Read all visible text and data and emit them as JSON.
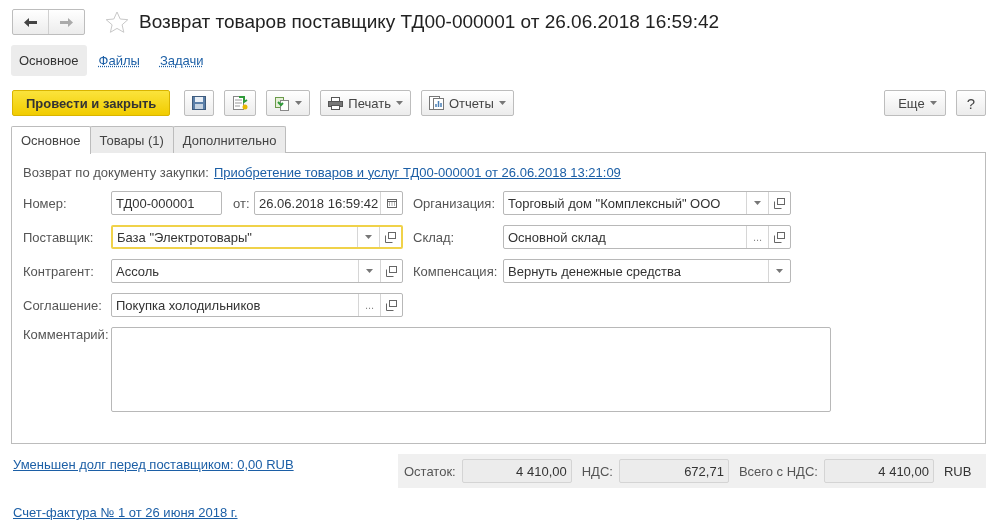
{
  "header": {
    "title": "Возврат товаров поставщику ТД00-000001 от 26.06.2018 16:59:42",
    "favorite": false
  },
  "sections": [
    {
      "label": "Основное",
      "selected": true
    },
    {
      "label": "Файлы",
      "selected": false
    },
    {
      "label": "Задачи",
      "selected": false
    }
  ],
  "toolbar": {
    "primary": "Провести и закрыть",
    "print": "Печать",
    "reports": "Отчеты",
    "more": "Еще",
    "help": "?"
  },
  "tabs": [
    {
      "label": "Основное",
      "selected": true
    },
    {
      "label": "Товары (1)",
      "selected": false
    },
    {
      "label": "Дополнительно",
      "selected": false
    }
  ],
  "basis": {
    "label": "Возврат по документу закупки:",
    "link": "Приобретение товаров и услуг ТД00-000001 от 26.06.2018 13:21:09"
  },
  "number": {
    "label": "Номер:",
    "value": "ТД00-000001",
    "date_label": "от:",
    "date": "26.06.2018 16:59:42"
  },
  "left_fields": [
    {
      "label": "Поставщик:",
      "value": "База \"Электротовары\"",
      "focused": true,
      "dropdown": true,
      "open": true
    },
    {
      "label": "Контрагент:",
      "value": "Ассоль",
      "focused": false,
      "dropdown": true,
      "open": true
    },
    {
      "label": "Соглашение:",
      "value": "Покупка холодильников",
      "focused": false,
      "choose": "...",
      "dropdown": false,
      "open": true
    }
  ],
  "right_fields": [
    {
      "label": "Организация:",
      "value": "Торговый дом \"Комплексный\" ООО",
      "focused": false,
      "dropdown": true,
      "open": true
    },
    {
      "label": "Склад:",
      "value": "Основной склад",
      "focused": false,
      "choose": "...",
      "dropdown": false,
      "open": true
    },
    {
      "label": "Компенсация:",
      "value": "Вернуть денежные средства",
      "focused": false,
      "dropdown": true,
      "open": false
    }
  ],
  "comment": {
    "label": "Комментарий:"
  },
  "debt_link": "Уменьшен долг перед поставщиком: 0,00 RUB",
  "totals": [
    {
      "label": "Остаток:",
      "value": "4 410,00"
    },
    {
      "label": "НДС:",
      "value": "672,71"
    },
    {
      "label": "Всего с НДС:",
      "value": "4 410,00"
    }
  ],
  "currency": "RUB",
  "invoice_link": "Счет-фактура № 1 от 26 июня 2018 г."
}
